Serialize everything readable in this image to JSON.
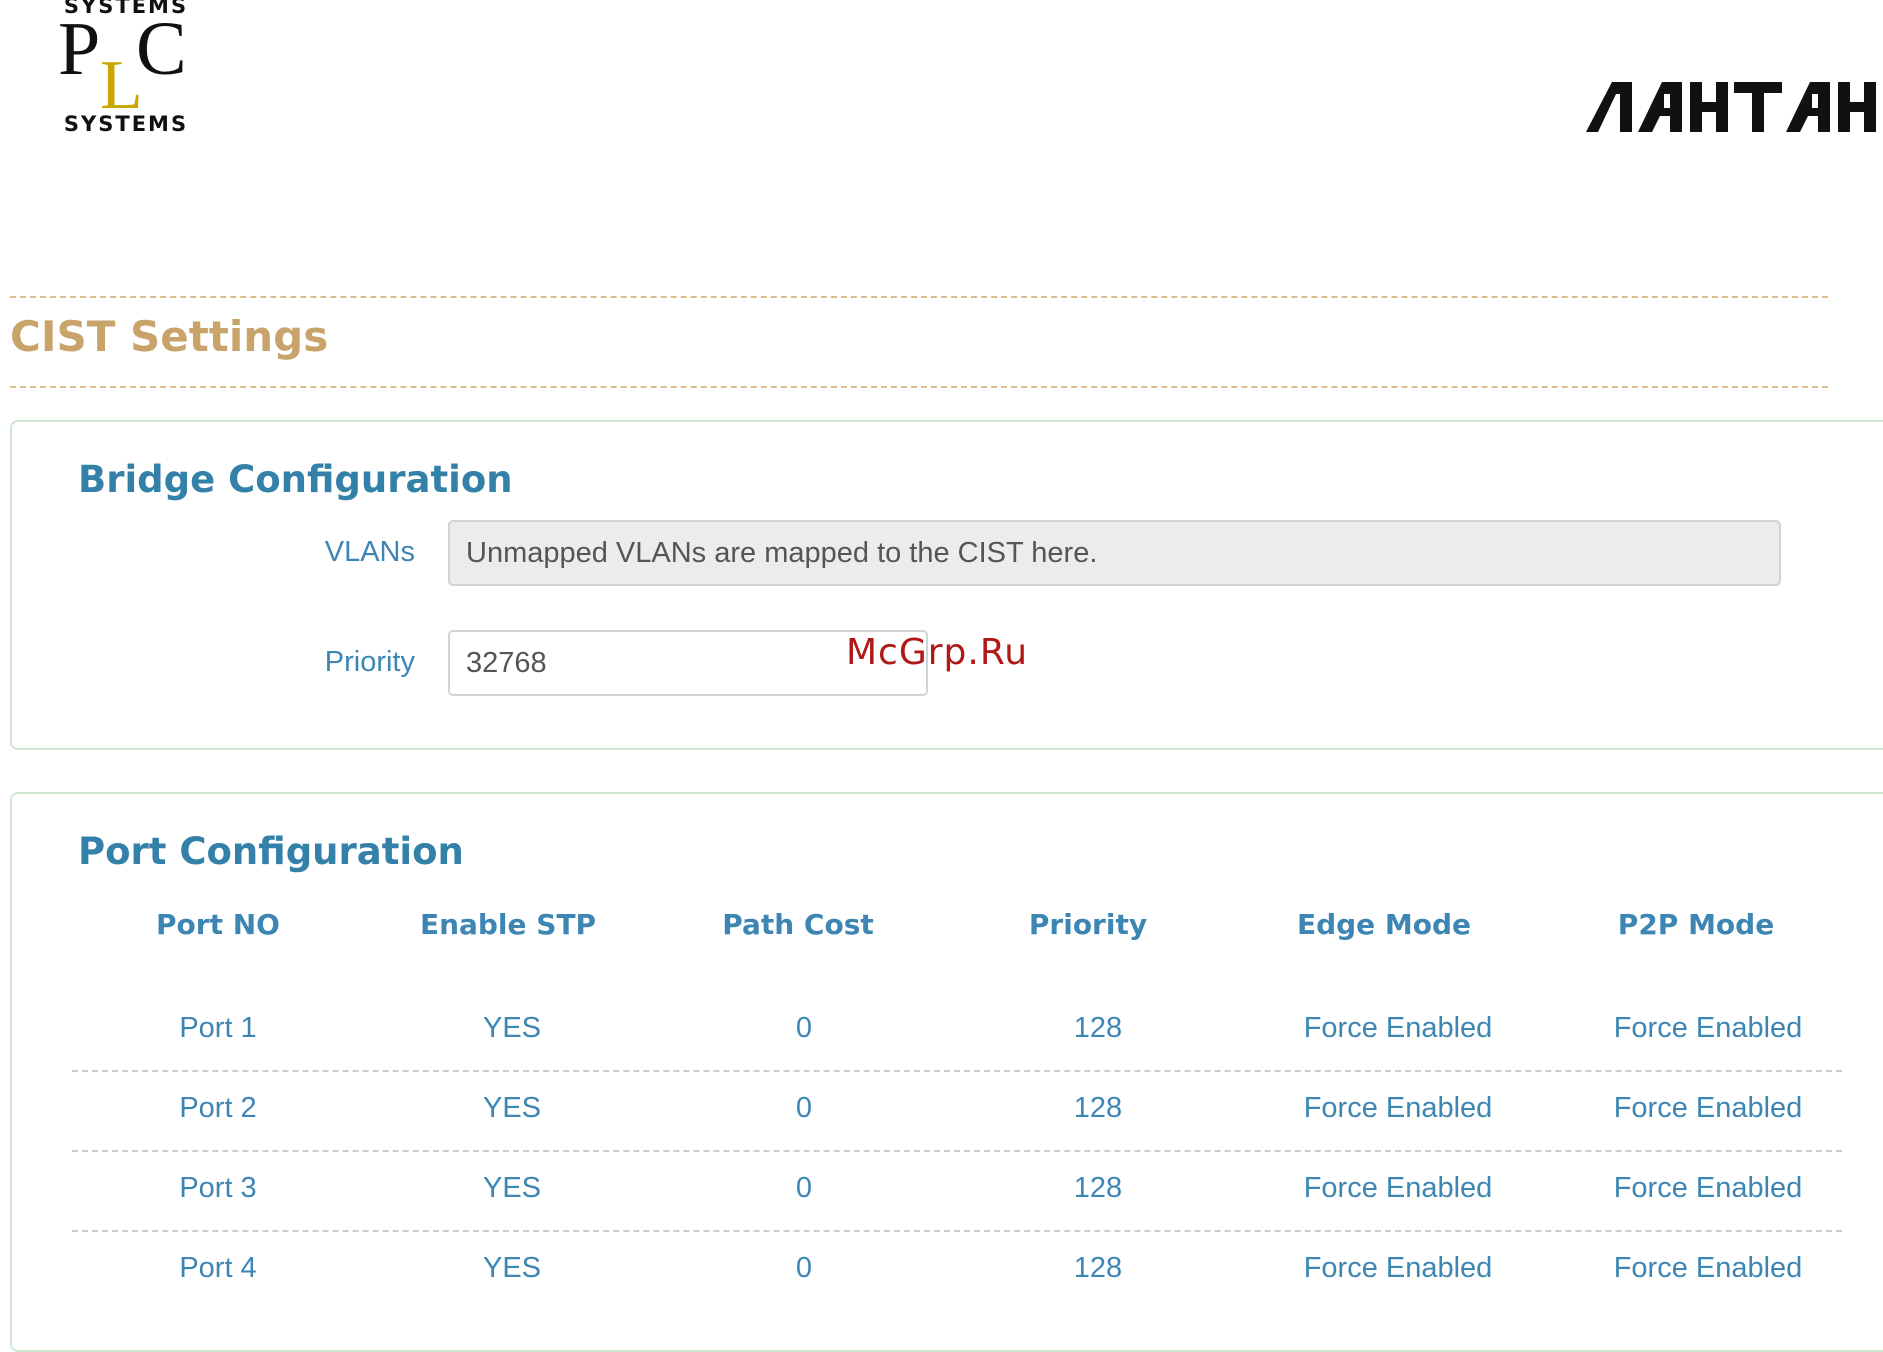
{
  "logos": {
    "plc": {
      "top_text": "SYSTEMS",
      "letters": "PLC",
      "bottom_text": "SYSTEMS",
      "gold_color": "#c8a800"
    },
    "lahtah": {
      "text": "ЛАНТАН"
    }
  },
  "page": {
    "title": "CIST Settings",
    "title_color": "#c9a46a"
  },
  "bridge": {
    "title": "Bridge Configuration",
    "vlans_label": "VLANs",
    "vlans_placeholder": "Unmapped VLANs are mapped to the CIST here.",
    "priority_label": "Priority",
    "priority_value": "32768"
  },
  "watermark": "McGrp.Ru",
  "ports": {
    "title": "Port Configuration",
    "columns": [
      "Port NO",
      "Enable STP",
      "Path Cost",
      "Priority",
      "Edge Mode",
      "P2P Mode"
    ],
    "rows": [
      {
        "port": "Port 1",
        "stp": "YES",
        "cost": "0",
        "priority": "128",
        "edge": "Force Enabled",
        "p2p": "Force Enabled"
      },
      {
        "port": "Port 2",
        "stp": "YES",
        "cost": "0",
        "priority": "128",
        "edge": "Force Enabled",
        "p2p": "Force Enabled"
      },
      {
        "port": "Port 3",
        "stp": "YES",
        "cost": "0",
        "priority": "128",
        "edge": "Force Enabled",
        "p2p": "Force Enabled"
      },
      {
        "port": "Port 4",
        "stp": "YES",
        "cost": "0",
        "priority": "128",
        "edge": "Force Enabled",
        "p2p": "Force Enabled"
      }
    ]
  }
}
